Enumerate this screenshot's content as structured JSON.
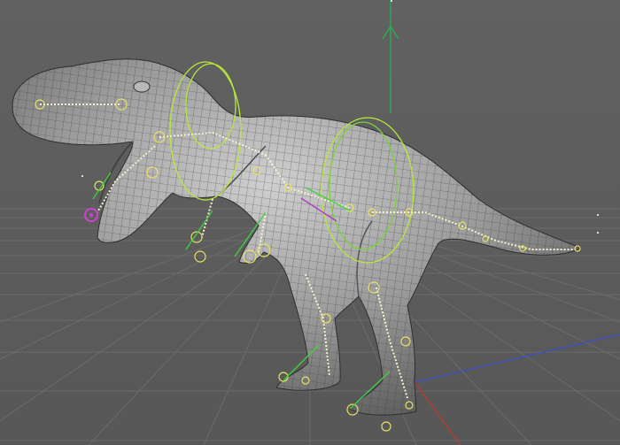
{
  "viewport": {
    "view": "perspective",
    "background_color": "#5e5e5e",
    "grid_color": "#6f6f6f",
    "axis_colors": {
      "x": "#c0392b",
      "y": "#2fa84f",
      "z": "#3c4fd0"
    },
    "model": "t-rex-rigged-mesh",
    "rig_colors": {
      "controllers": "#b8e83a",
      "joints": "#e8e066",
      "ik_handles": "#3fd23f",
      "selection": "#d040d0"
    }
  }
}
